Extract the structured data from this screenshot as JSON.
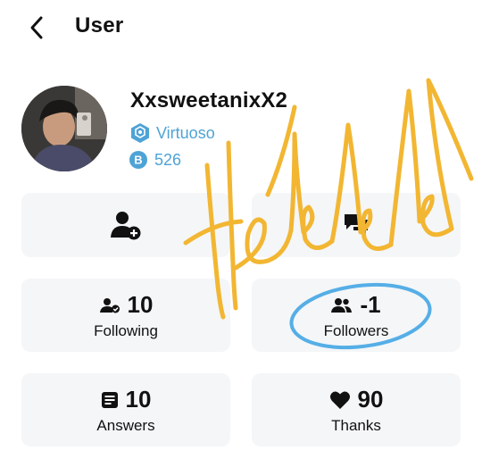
{
  "header": {
    "title": "User"
  },
  "profile": {
    "username": "XxsweetanixX2",
    "rank": "Virtuoso",
    "points": "526"
  },
  "stats": {
    "following": {
      "value": "10",
      "label": "Following"
    },
    "followers": {
      "value": "-1",
      "label": "Followers"
    },
    "answers": {
      "value": "10",
      "label": "Answers"
    },
    "thanks": {
      "value": "90",
      "label": "Thanks"
    }
  },
  "icons": {
    "back": "chevron-left-icon",
    "rank": "virtuoso-badge-icon",
    "points": "brainly-points-icon",
    "add_friend": "add-friend-icon",
    "message": "message-icon",
    "following": "following-icon",
    "followers": "followers-icon",
    "answers": "answers-icon",
    "thanks": "heart-icon"
  },
  "colors": {
    "accent": "#4ea3d6",
    "card_bg": "#f4f6f8",
    "scribble_yellow": "#f2b632",
    "circle_blue": "#55aee6"
  }
}
